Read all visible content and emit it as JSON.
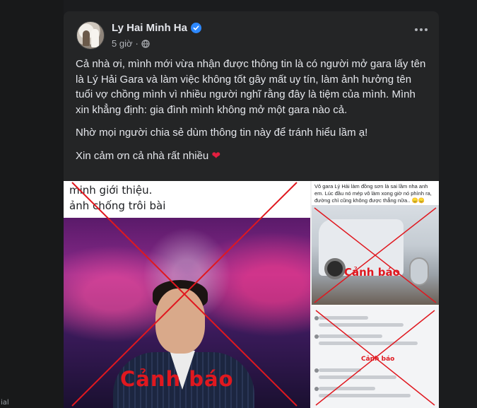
{
  "post": {
    "author": "Ly Hai Minh Ha",
    "time": "5 giờ",
    "separator": "·",
    "paragraphs": [
      "Cả nhà ơi, mình mới vừa nhận được thông tin là có người mở gara lấy tên là Lý Hải Gara và làm việc không tốt gây mất uy tín, làm ảnh hưởng tên tuổi vợ chồng mình vì nhiều người nghĩ rằng đây là tiệm của mình. Mình xin khẳng định: gia đình mình không mở một gara nào cả.",
      "Nhờ mọi người chia sẻ dùm thông tin này để tránh hiểu lầm ạ!",
      "Xin cảm ơn cả nhà rất nhiều"
    ],
    "heart": "❤"
  },
  "images": {
    "left_caption_1": "minh giới thiệu.",
    "left_caption_2": "ảnh chống trôi bài",
    "left_warning": "Cảnh báo",
    "right_top_caption": "Vô gara Lý Hải làm đồng sơn là sai lầm nha anh em. Lúc đầu nó mép vô làm xong giờ nó phình ra, đường chỉ cũng không được thẳng nữa.. 😞😞",
    "right_top_warning": "Cảnh báo",
    "right_bottom_warning": "Cảnh báo"
  },
  "edge_label": "ial",
  "colors": {
    "card_bg": "#242526",
    "page_bg": "#1b1c1e",
    "verified_blue": "#2d88ff",
    "warning_red": "#e0181f",
    "heart_red": "#e41e3f"
  },
  "icons": [
    "verified-badge-icon",
    "globe-icon",
    "more-options-icon",
    "heart-icon"
  ]
}
